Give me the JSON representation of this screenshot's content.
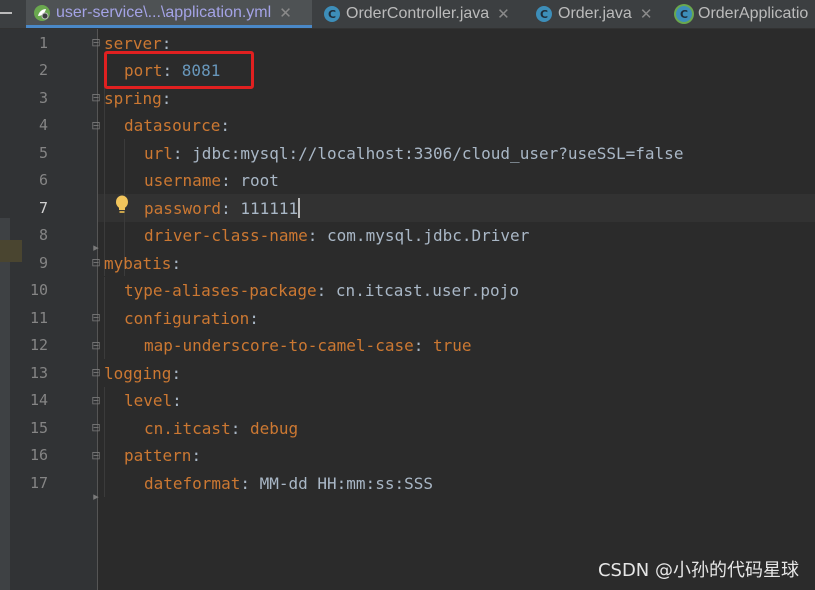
{
  "tabs": [
    {
      "label": "user-service\\...\\application.yml",
      "icon": "spring-config-icon",
      "active": true,
      "closable": true
    },
    {
      "label": "OrderController.java",
      "icon": "class-icon",
      "active": false,
      "closable": true
    },
    {
      "label": "Order.java",
      "icon": "class-icon",
      "active": false,
      "closable": true
    },
    {
      "label": "OrderApplicatio",
      "icon": "spring-class-icon",
      "active": false,
      "closable": false
    }
  ],
  "tab_close_glyph": "✕",
  "class_icon_letter": "C",
  "editor": {
    "current_line": 7,
    "lines": [
      {
        "n": "1",
        "key": "server",
        "sep": ":",
        "value": ""
      },
      {
        "n": "2",
        "key": "port",
        "sep": ": ",
        "value": "8081"
      },
      {
        "n": "3",
        "key": "spring",
        "sep": ":",
        "value": ""
      },
      {
        "n": "4",
        "key": "datasource",
        "sep": ":",
        "value": ""
      },
      {
        "n": "5",
        "key": "url",
        "sep": ": ",
        "value": "jdbc:mysql://localhost:3306/cloud_user?useSSL=false"
      },
      {
        "n": "6",
        "key": "username",
        "sep": ": ",
        "value": "root"
      },
      {
        "n": "7",
        "key": "password",
        "sep": ": ",
        "value": "111111"
      },
      {
        "n": "8",
        "key": "driver-class-name",
        "sep": ": ",
        "value": "com.mysql.jdbc.Driver"
      },
      {
        "n": "9",
        "key": "mybatis",
        "sep": ":",
        "value": ""
      },
      {
        "n": "10",
        "key": "type-aliases-package",
        "sep": ": ",
        "value": "cn.itcast.user.pojo"
      },
      {
        "n": "11",
        "key": "configuration",
        "sep": ":",
        "value": ""
      },
      {
        "n": "12",
        "key": "map-underscore-to-camel-case",
        "sep": ": ",
        "value": "true"
      },
      {
        "n": "13",
        "key": "logging",
        "sep": ":",
        "value": ""
      },
      {
        "n": "14",
        "key": "level",
        "sep": ":",
        "value": ""
      },
      {
        "n": "15",
        "key": "cn.itcast",
        "sep": ": ",
        "value": "debug"
      },
      {
        "n": "16",
        "key": "pattern",
        "sep": ":",
        "value": ""
      },
      {
        "n": "17",
        "key": "dateformat",
        "sep": ": ",
        "value": "MM-dd HH:mm:ss:SSS"
      }
    ]
  },
  "colors": {
    "key": "#cc7832",
    "number": "#6897bb",
    "text": "#a9b7c6",
    "highlight_box": "#e02020"
  },
  "watermark": "CSDN @小孙的代码星球"
}
